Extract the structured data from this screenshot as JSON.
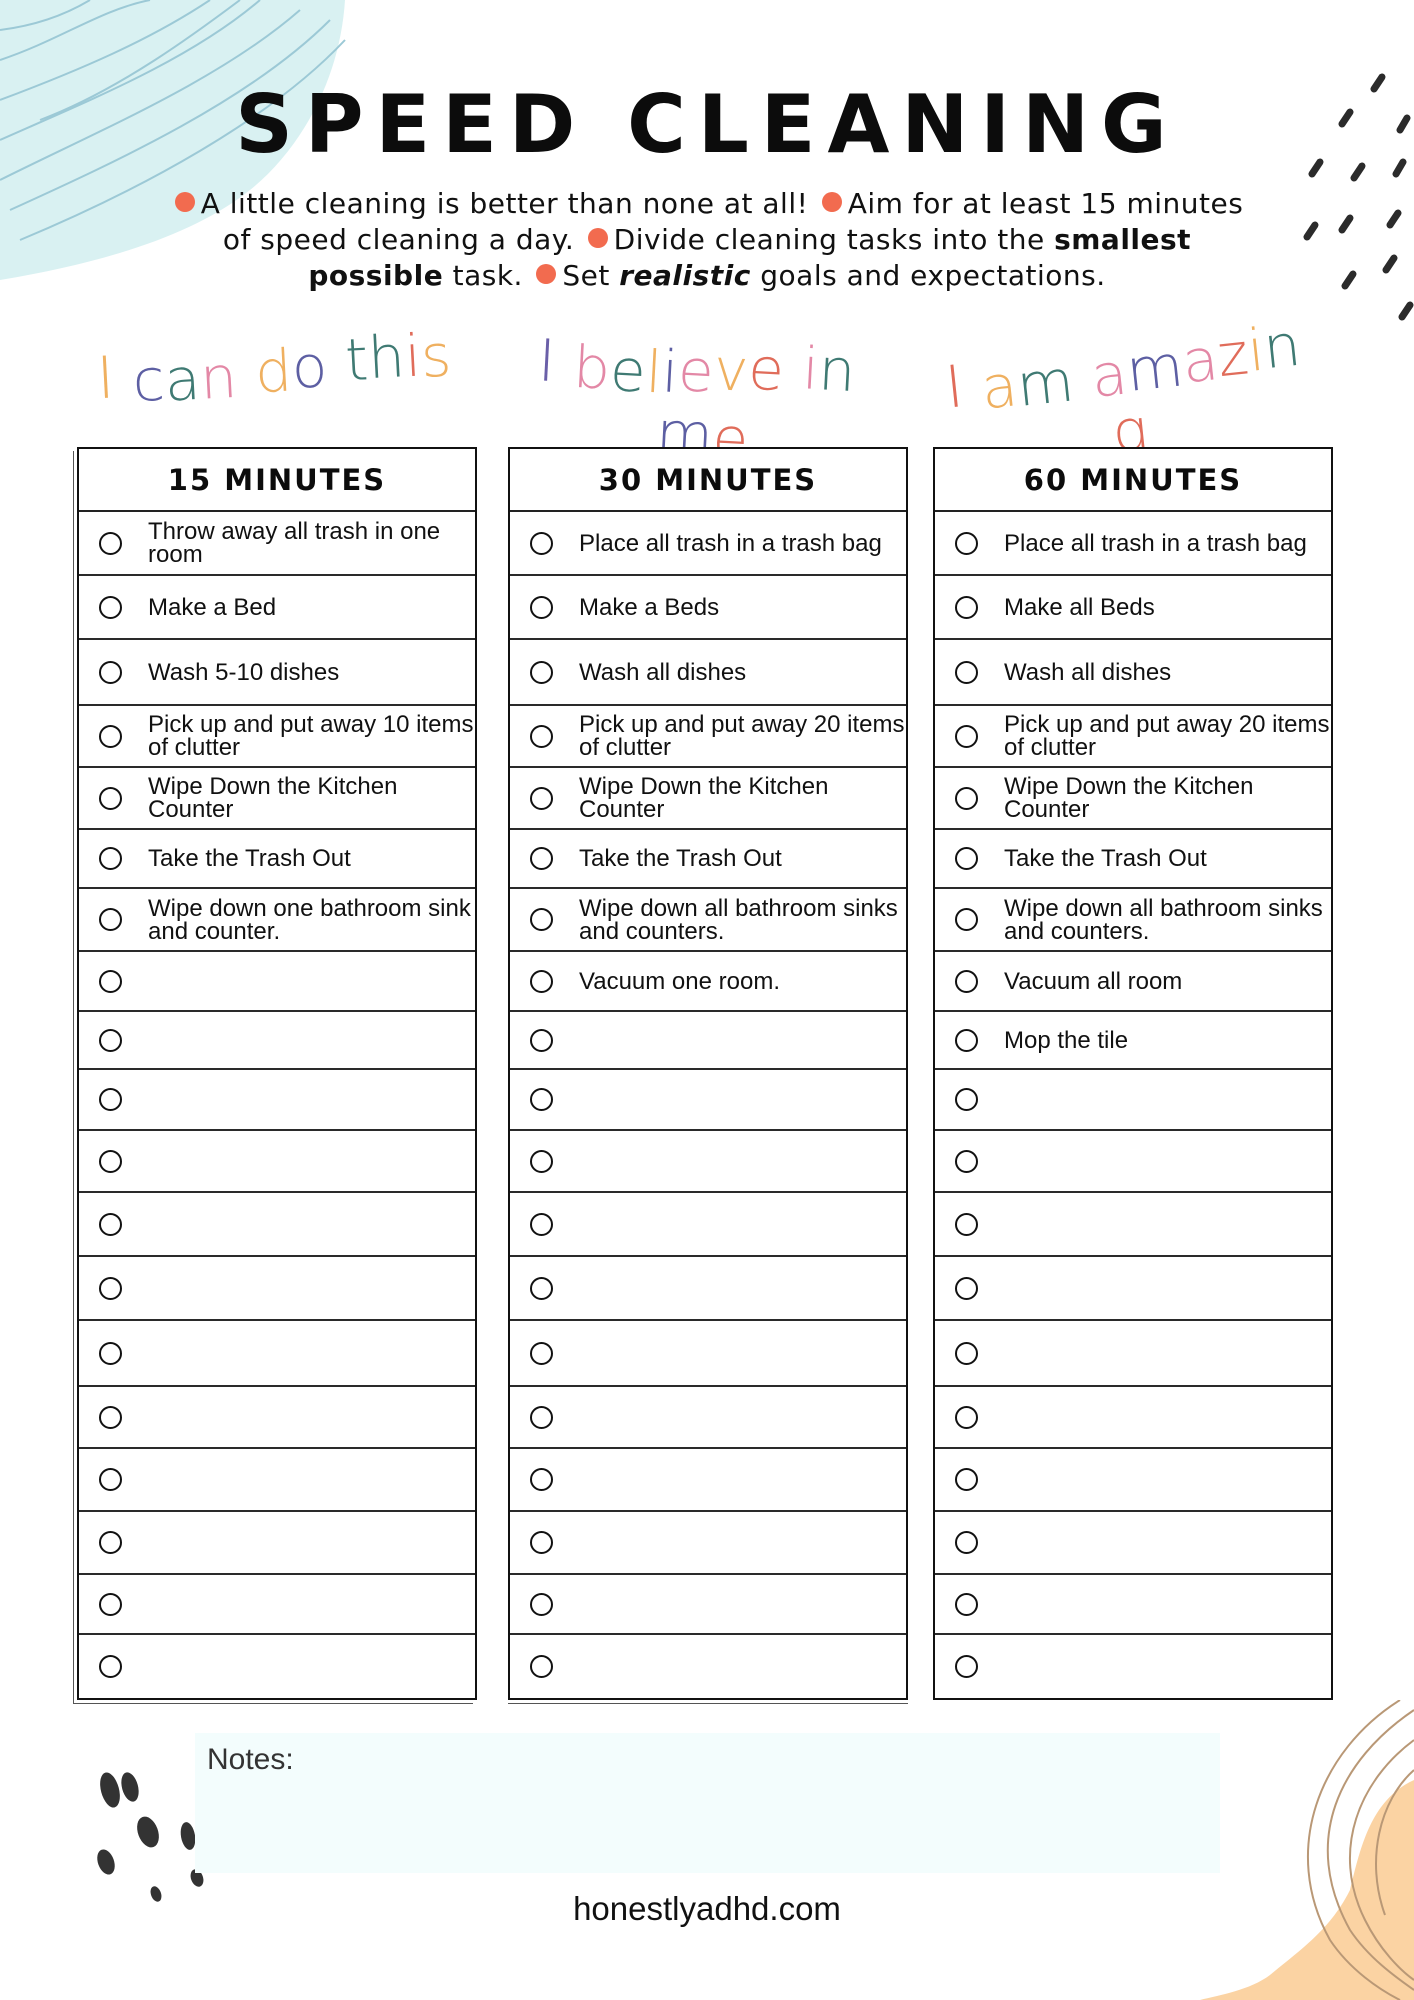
{
  "page": {
    "title": "SPEED CLEANING",
    "tips": [
      {
        "parts": [
          {
            "text": "A little cleaning is better than none at all!",
            "style": "normal"
          }
        ]
      },
      {
        "parts": [
          {
            "text": "Aim for at least 15 minutes of speed cleaning a day.",
            "style": "normal"
          }
        ]
      },
      {
        "parts": [
          {
            "text": "Divide cleaning tasks into the ",
            "style": "normal"
          },
          {
            "text": "smallest possible",
            "style": "bold"
          },
          {
            "text": " task.",
            "style": "normal"
          }
        ]
      },
      {
        "parts": [
          {
            "text": "Set ",
            "style": "normal"
          },
          {
            "text": "realistic",
            "style": "bold-italic"
          },
          {
            "text": " goals and expectations.",
            "style": "normal"
          }
        ]
      }
    ],
    "bullet_color": "#f26b4f",
    "affirmations": [
      {
        "text": "I can do this",
        "colors": [
          "#efb060",
          "#ffffff",
          "#5d5fa3",
          "#3f7a73",
          "#e388a6",
          "#ffffff",
          "#efb060",
          "#5d5fa3",
          "#ffffff",
          "#3f7a73",
          "#3f7a73",
          "#e06c5a",
          "#efb060"
        ]
      },
      {
        "text": "I believe in me",
        "colors": [
          "#6a5fa8",
          "#ffffff",
          "#e388a6",
          "#3f7a73",
          "#efb060",
          "#5d5fa3",
          "#e388a6",
          "#efb060",
          "#e06c5a",
          "#ffffff",
          "#e388a6",
          "#3f7a73",
          "#ffffff",
          "#5d5fa3",
          "#e06c5a"
        ]
      },
      {
        "text": "I am amazing",
        "colors": [
          "#e06c5a",
          "#ffffff",
          "#efb060",
          "#3f7a73",
          "#ffffff",
          "#e388a6",
          "#5d5fa3",
          "#e388a6",
          "#e06c5a",
          "#efb060",
          "#3f7a73",
          "#e06c5a"
        ]
      }
    ],
    "columns": [
      {
        "header": "15 MINUTES",
        "tasks": [
          "Throw away all trash in one room",
          "Make a Bed",
          "Wash 5-10 dishes",
          "Pick up and put away 10 items of clutter",
          "Wipe Down the Kitchen Counter",
          "Take the Trash Out",
          "Wipe down one bathroom sink and counter.",
          "",
          "",
          "",
          "",
          "",
          "",
          "",
          "",
          "",
          "",
          "",
          ""
        ]
      },
      {
        "header": "30 MINUTES",
        "tasks": [
          "Place all trash in a trash bag",
          "Make a Beds",
          "Wash all dishes",
          "Pick up and put away 20 items of clutter",
          "Wipe Down the Kitchen Counter",
          "Take the Trash Out",
          "Wipe down all bathroom sinks and counters.",
          "Vacuum one room.",
          "",
          "",
          "",
          "",
          "",
          "",
          "",
          "",
          "",
          "",
          ""
        ]
      },
      {
        "header": "60 MINUTES",
        "tasks": [
          "Place all trash in a trash bag",
          "Make all Beds",
          "Wash all dishes",
          "Pick up and put away 20 items of clutter",
          "Wipe Down the Kitchen Counter",
          "Take the Trash Out",
          "Wipe down all bathroom sinks and counters.",
          "Vacuum all room",
          "Mop the tile",
          "",
          "",
          "",
          "",
          "",
          "",
          "",
          "",
          "",
          ""
        ]
      }
    ],
    "notes_label": "Notes:",
    "footer": "honestlyadhd.com",
    "colors": {
      "notes_bg": "#f3fdfd",
      "blue_wash": "#cdebee",
      "peach_wash": "#fbd3a3"
    }
  }
}
